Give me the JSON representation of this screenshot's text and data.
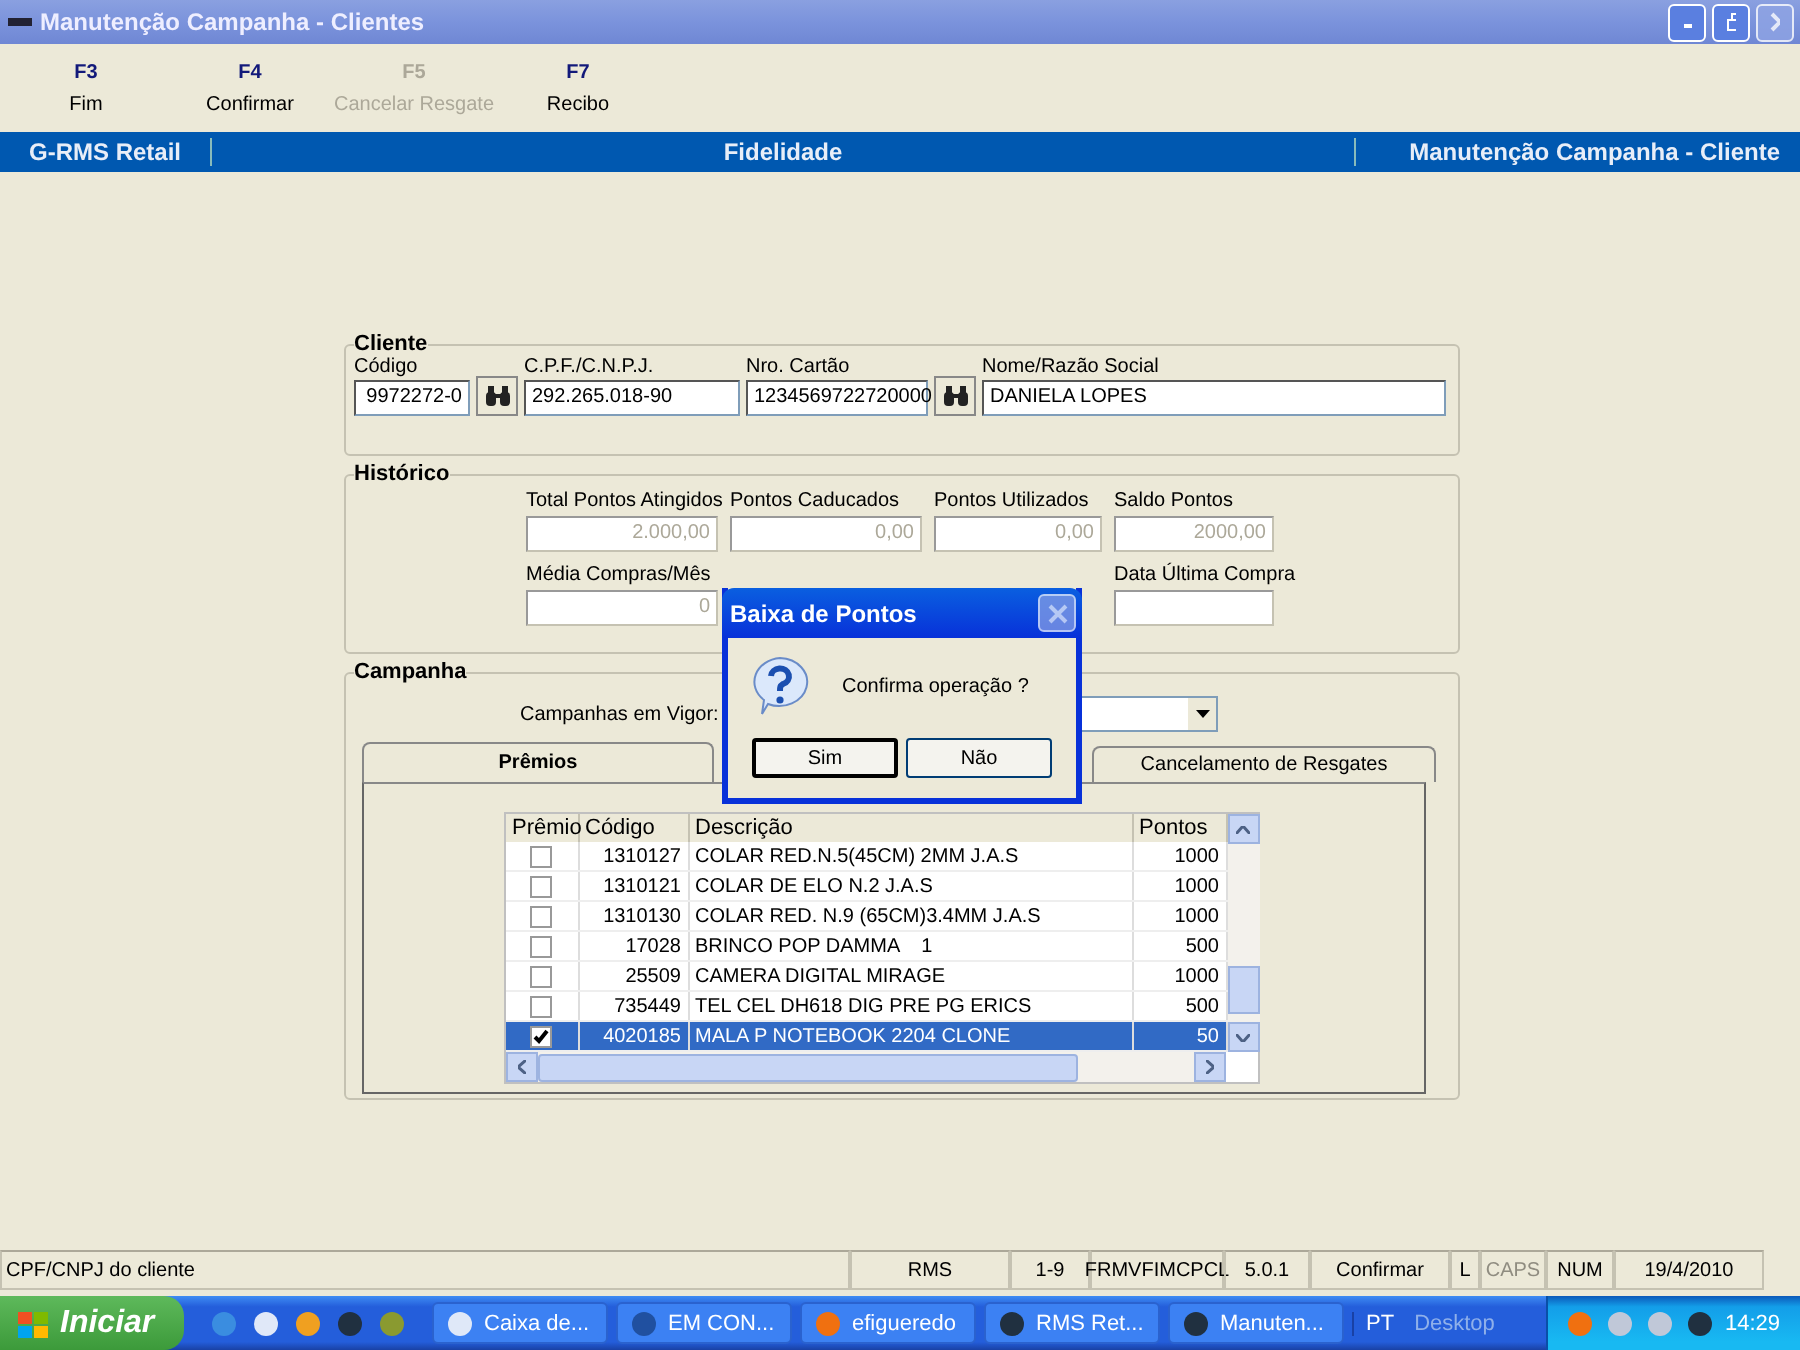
{
  "window": {
    "title": "Manutenção Campanha - Clientes"
  },
  "toolbar": [
    {
      "key": "F3",
      "label": "Fim",
      "disabled": false
    },
    {
      "key": "F4",
      "label": "Confirmar",
      "disabled": false
    },
    {
      "key": "F5",
      "label": "Cancelar Resgate",
      "disabled": true
    },
    {
      "key": "F7",
      "label": "Recibo",
      "disabled": false
    }
  ],
  "header": {
    "left": "G-RMS Retail",
    "center": "Fidelidade",
    "right": "Manutenção Campanha - Cliente"
  },
  "cliente": {
    "title": "Cliente",
    "fields": [
      {
        "label": "Código",
        "value": "9972272-0",
        "lookup": true
      },
      {
        "label": "C.P.F./C.N.P.J.",
        "value": "292.265.018-90",
        "lookup": false
      },
      {
        "label": "Nro. Cartão",
        "value": "1234569722720000",
        "lookup": true
      },
      {
        "label": "Nome/Razão Social",
        "value": "DANIELA LOPES",
        "lookup": false
      }
    ]
  },
  "historico": {
    "title": "Histórico",
    "fields": [
      {
        "label": "Total Pontos Atingidos",
        "value": "2.000,00",
        "disabled": true
      },
      {
        "label": "Pontos Caducados",
        "value": "0,00",
        "disabled": true
      },
      {
        "label": "Pontos Utilizados",
        "value": "0,00",
        "disabled": true
      },
      {
        "label": "Saldo Pontos",
        "value": "2000,00",
        "disabled": true
      },
      {
        "label": "Média Compras/Mês",
        "value": "0",
        "disabled": true
      },
      {
        "kind": "hidden"
      },
      {
        "kind": "hidden"
      },
      {
        "label": "Data Última Compra",
        "disabled": true
      }
    ]
  },
  "campanha": {
    "title": "Campanha",
    "campaign_label": "Campanhas em Vigor:",
    "tabs": [
      {
        "label": "Prêmios",
        "selected": true
      },
      {
        "label": "Cancelamento de Resgates",
        "selected": false
      }
    ],
    "table": {
      "columns": [
        "Prêmio",
        "Código",
        "Descrição",
        "Pontos"
      ],
      "rows": [
        {
          "checked": false,
          "code": "1310127",
          "description": "COLAR RED.N.5(45CM) 2MM J.A.S",
          "points": "1000",
          "selected": false
        },
        {
          "checked": false,
          "code": "1310121",
          "description": "COLAR DE ELO N.2 J.A.S",
          "points": "1000",
          "selected": false
        },
        {
          "checked": false,
          "code": "1310130",
          "description": "COLAR RED. N.9 (65CM)3.4MM J.A.S",
          "points": "1000",
          "selected": false
        },
        {
          "checked": false,
          "code": "17028",
          "description": "BRINCO POP DAMMA    1",
          "points": "500",
          "selected": false
        },
        {
          "checked": false,
          "code": "25509",
          "description": "CAMERA DIGITAL MIRAGE",
          "points": "1000",
          "selected": false
        },
        {
          "checked": false,
          "code": "735449",
          "description": "TEL CEL DH618 DIG PRE PG ERICS",
          "points": "500",
          "selected": false
        },
        {
          "checked": true,
          "code": "4020185",
          "description": "MALA P NOTEBOOK 2204 CLONE",
          "points": "50",
          "selected": true
        }
      ]
    }
  },
  "dialog": {
    "title": "Baixa de Pontos",
    "message": "Confirma operação ?",
    "buttons": [
      "Sim",
      "Não"
    ]
  },
  "status_bar": [
    {
      "text": "CPF/CNPJ do cliente",
      "disabled": false
    },
    {
      "text": "RMS",
      "disabled": false
    },
    {
      "text": "1-9",
      "disabled": false
    },
    {
      "text": "FRMVFIMCPCL",
      "disabled": false
    },
    {
      "text": "5.0.1",
      "disabled": false
    },
    {
      "text": "Confirmar",
      "disabled": false
    },
    {
      "text": "L",
      "disabled": false
    },
    {
      "text": "CAPS",
      "disabled": true
    },
    {
      "text": "NUM",
      "disabled": false
    },
    {
      "text": "19/4/2010",
      "disabled": false
    }
  ],
  "taskbar": {
    "start": "Iniciar",
    "tasks": [
      "Caixa de...",
      "EM CON...",
      "efigueredo",
      "RMS Ret...",
      "Manuten..."
    ],
    "language": "PT",
    "desktop": "Desktop",
    "clock": "14:29"
  }
}
